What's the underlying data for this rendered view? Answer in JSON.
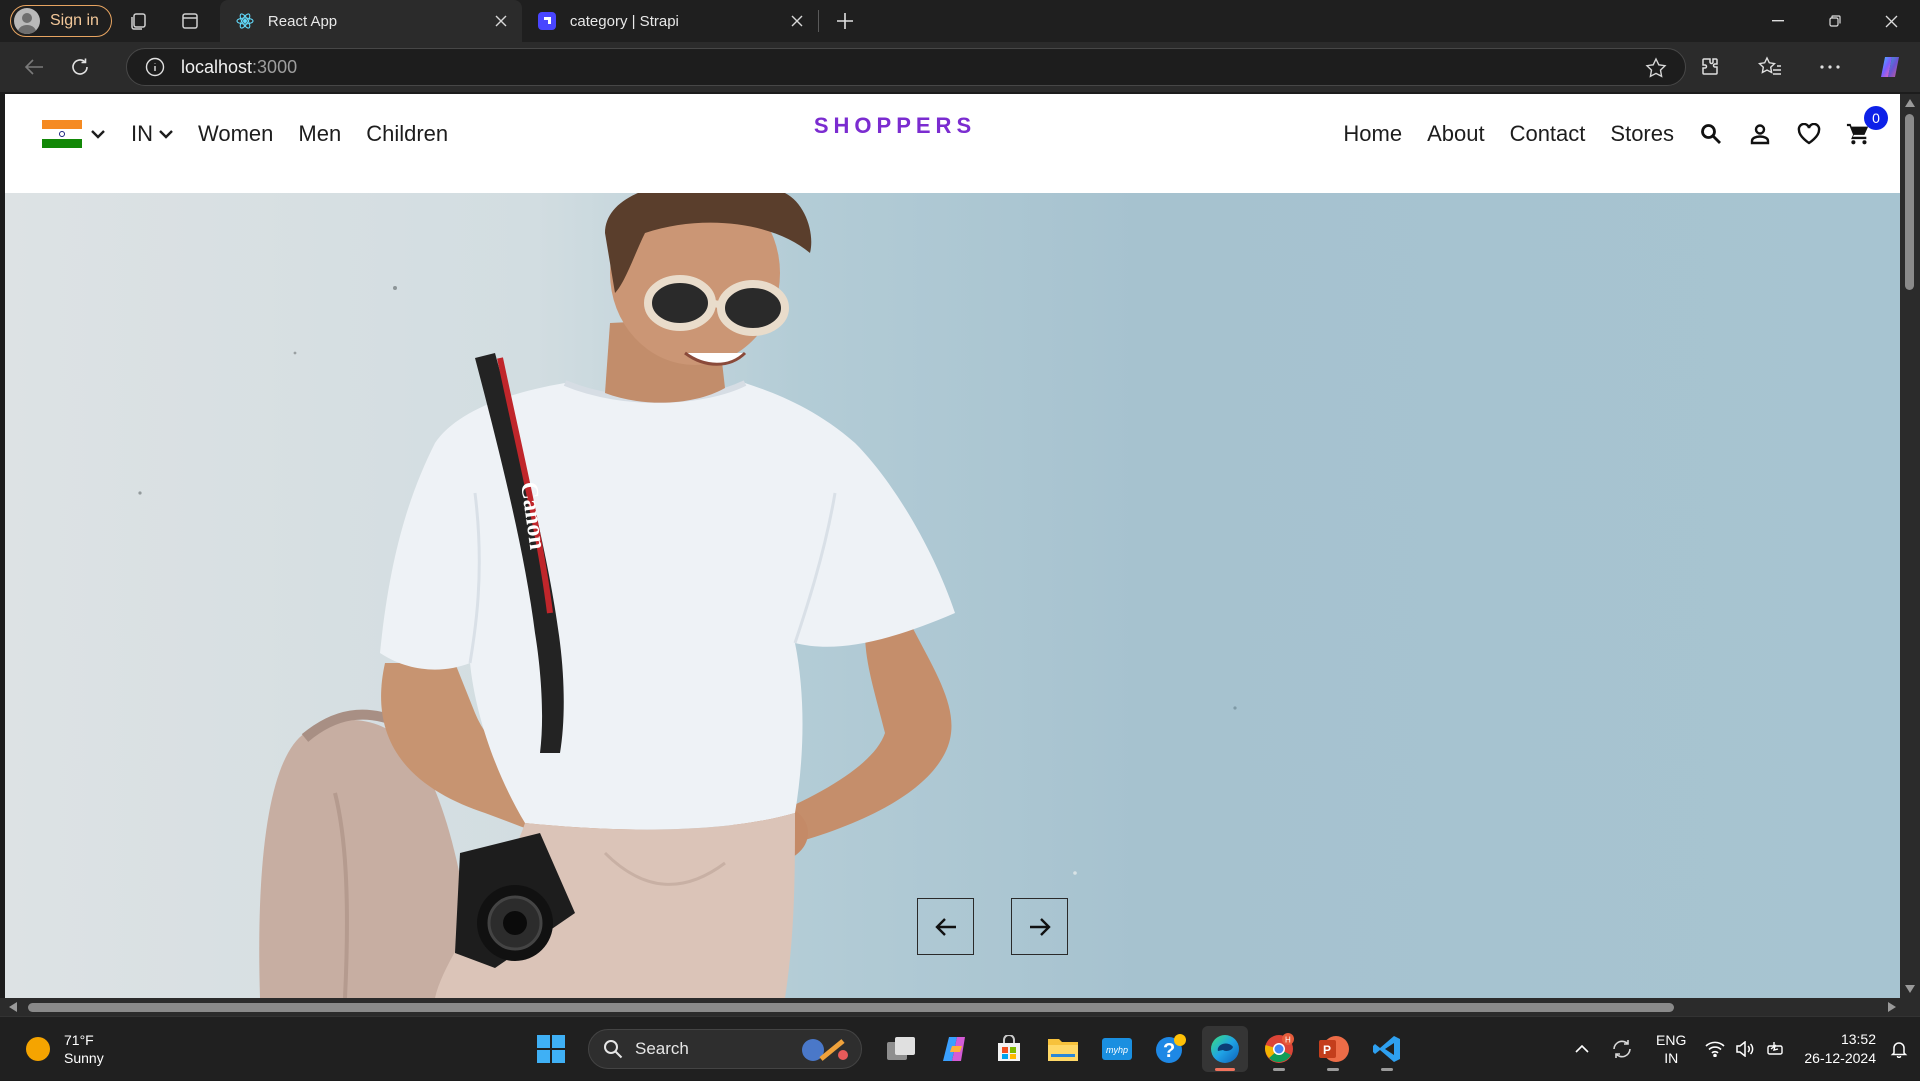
{
  "browser": {
    "signin_label": "Sign in",
    "tabs": [
      {
        "title": "React App",
        "favicon": "react-icon",
        "active": true
      },
      {
        "title": "category | Strapi",
        "favicon": "strapi-icon",
        "active": false
      }
    ],
    "address": {
      "host": "localhost",
      "port": ":3000"
    }
  },
  "site": {
    "country_flag": "india-flag-icon",
    "currency": "IN",
    "left_nav": [
      "Women",
      "Men",
      "Children"
    ],
    "logo": "SHOPPERS",
    "right_nav": [
      "Home",
      "About",
      "Contact",
      "Stores"
    ],
    "cart_count": "0",
    "accent_color": "#7b2cd0",
    "badge_color": "#0d21e8"
  },
  "hero": {
    "image": "photo of smiling woman in white t-shirt with sunglasses and Canon camera leaning against light blue wall",
    "camera_strap_text": "Canon"
  },
  "taskbar": {
    "weather": {
      "temp": "71°F",
      "condition": "Sunny"
    },
    "search_label": "Search",
    "language": {
      "line1": "ENG",
      "line2": "IN"
    },
    "clock": {
      "time": "13:52",
      "date": "26-12-2024"
    }
  }
}
